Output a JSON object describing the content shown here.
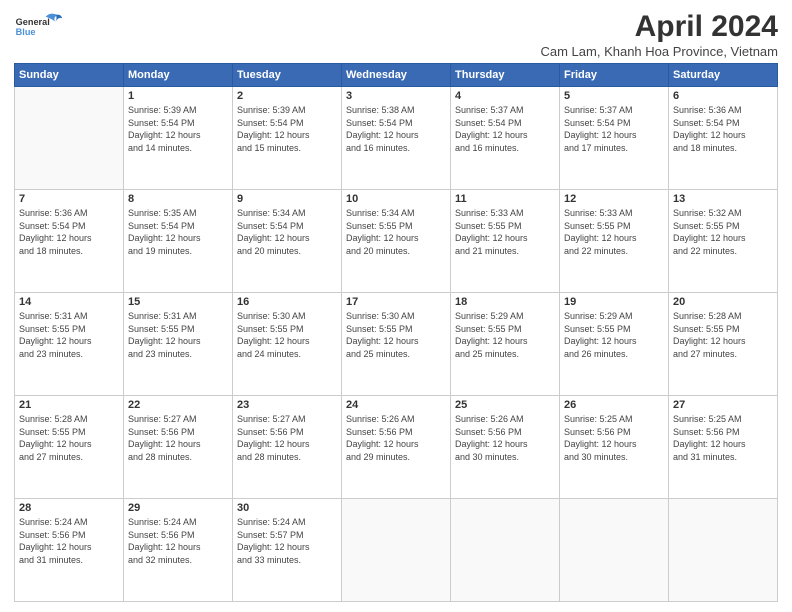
{
  "header": {
    "logo_text_general": "General",
    "logo_text_blue": "Blue",
    "month": "April 2024",
    "location": "Cam Lam, Khanh Hoa Province, Vietnam"
  },
  "columns": [
    "Sunday",
    "Monday",
    "Tuesday",
    "Wednesday",
    "Thursday",
    "Friday",
    "Saturday"
  ],
  "weeks": [
    [
      {
        "day": "",
        "info": ""
      },
      {
        "day": "1",
        "info": "Sunrise: 5:39 AM\nSunset: 5:54 PM\nDaylight: 12 hours\nand 14 minutes."
      },
      {
        "day": "2",
        "info": "Sunrise: 5:39 AM\nSunset: 5:54 PM\nDaylight: 12 hours\nand 15 minutes."
      },
      {
        "day": "3",
        "info": "Sunrise: 5:38 AM\nSunset: 5:54 PM\nDaylight: 12 hours\nand 16 minutes."
      },
      {
        "day": "4",
        "info": "Sunrise: 5:37 AM\nSunset: 5:54 PM\nDaylight: 12 hours\nand 16 minutes."
      },
      {
        "day": "5",
        "info": "Sunrise: 5:37 AM\nSunset: 5:54 PM\nDaylight: 12 hours\nand 17 minutes."
      },
      {
        "day": "6",
        "info": "Sunrise: 5:36 AM\nSunset: 5:54 PM\nDaylight: 12 hours\nand 18 minutes."
      }
    ],
    [
      {
        "day": "7",
        "info": "Sunrise: 5:36 AM\nSunset: 5:54 PM\nDaylight: 12 hours\nand 18 minutes."
      },
      {
        "day": "8",
        "info": "Sunrise: 5:35 AM\nSunset: 5:54 PM\nDaylight: 12 hours\nand 19 minutes."
      },
      {
        "day": "9",
        "info": "Sunrise: 5:34 AM\nSunset: 5:54 PM\nDaylight: 12 hours\nand 20 minutes."
      },
      {
        "day": "10",
        "info": "Sunrise: 5:34 AM\nSunset: 5:55 PM\nDaylight: 12 hours\nand 20 minutes."
      },
      {
        "day": "11",
        "info": "Sunrise: 5:33 AM\nSunset: 5:55 PM\nDaylight: 12 hours\nand 21 minutes."
      },
      {
        "day": "12",
        "info": "Sunrise: 5:33 AM\nSunset: 5:55 PM\nDaylight: 12 hours\nand 22 minutes."
      },
      {
        "day": "13",
        "info": "Sunrise: 5:32 AM\nSunset: 5:55 PM\nDaylight: 12 hours\nand 22 minutes."
      }
    ],
    [
      {
        "day": "14",
        "info": "Sunrise: 5:31 AM\nSunset: 5:55 PM\nDaylight: 12 hours\nand 23 minutes."
      },
      {
        "day": "15",
        "info": "Sunrise: 5:31 AM\nSunset: 5:55 PM\nDaylight: 12 hours\nand 23 minutes."
      },
      {
        "day": "16",
        "info": "Sunrise: 5:30 AM\nSunset: 5:55 PM\nDaylight: 12 hours\nand 24 minutes."
      },
      {
        "day": "17",
        "info": "Sunrise: 5:30 AM\nSunset: 5:55 PM\nDaylight: 12 hours\nand 25 minutes."
      },
      {
        "day": "18",
        "info": "Sunrise: 5:29 AM\nSunset: 5:55 PM\nDaylight: 12 hours\nand 25 minutes."
      },
      {
        "day": "19",
        "info": "Sunrise: 5:29 AM\nSunset: 5:55 PM\nDaylight: 12 hours\nand 26 minutes."
      },
      {
        "day": "20",
        "info": "Sunrise: 5:28 AM\nSunset: 5:55 PM\nDaylight: 12 hours\nand 27 minutes."
      }
    ],
    [
      {
        "day": "21",
        "info": "Sunrise: 5:28 AM\nSunset: 5:55 PM\nDaylight: 12 hours\nand 27 minutes."
      },
      {
        "day": "22",
        "info": "Sunrise: 5:27 AM\nSunset: 5:56 PM\nDaylight: 12 hours\nand 28 minutes."
      },
      {
        "day": "23",
        "info": "Sunrise: 5:27 AM\nSunset: 5:56 PM\nDaylight: 12 hours\nand 28 minutes."
      },
      {
        "day": "24",
        "info": "Sunrise: 5:26 AM\nSunset: 5:56 PM\nDaylight: 12 hours\nand 29 minutes."
      },
      {
        "day": "25",
        "info": "Sunrise: 5:26 AM\nSunset: 5:56 PM\nDaylight: 12 hours\nand 30 minutes."
      },
      {
        "day": "26",
        "info": "Sunrise: 5:25 AM\nSunset: 5:56 PM\nDaylight: 12 hours\nand 30 minutes."
      },
      {
        "day": "27",
        "info": "Sunrise: 5:25 AM\nSunset: 5:56 PM\nDaylight: 12 hours\nand 31 minutes."
      }
    ],
    [
      {
        "day": "28",
        "info": "Sunrise: 5:24 AM\nSunset: 5:56 PM\nDaylight: 12 hours\nand 31 minutes."
      },
      {
        "day": "29",
        "info": "Sunrise: 5:24 AM\nSunset: 5:56 PM\nDaylight: 12 hours\nand 32 minutes."
      },
      {
        "day": "30",
        "info": "Sunrise: 5:24 AM\nSunset: 5:57 PM\nDaylight: 12 hours\nand 33 minutes."
      },
      {
        "day": "",
        "info": ""
      },
      {
        "day": "",
        "info": ""
      },
      {
        "day": "",
        "info": ""
      },
      {
        "day": "",
        "info": ""
      }
    ]
  ]
}
